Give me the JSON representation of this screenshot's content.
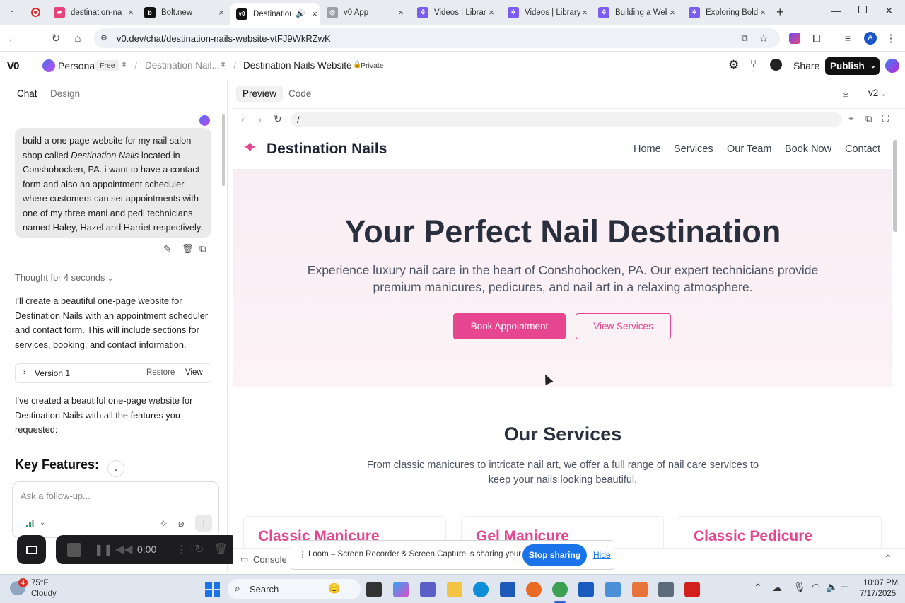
{
  "browser": {
    "tabs": [
      {
        "title": "destination-na",
        "color": "#e8437a",
        "glyph": "v0"
      },
      {
        "title": "Bolt.new",
        "color": "#111111",
        "glyph": "b"
      },
      {
        "title": "Destination",
        "color": "#111111",
        "glyph": "v0"
      },
      {
        "title": "v0 App",
        "color": "#666666",
        "glyph": "🌐"
      },
      {
        "title": "Videos | Library",
        "color": "#7b5cf0",
        "glyph": "✲"
      },
      {
        "title": "Videos | Library",
        "color": "#7b5cf0",
        "glyph": "✲"
      },
      {
        "title": "Building a Web",
        "color": "#7b5cf0",
        "glyph": "✲"
      },
      {
        "title": "Exploring Bold",
        "color": "#7b5cf0",
        "glyph": "✲"
      }
    ],
    "url": "v0.dev/chat/destination-nails-website-vtFJ9WkRZwK"
  },
  "app": {
    "workspace": "Personal",
    "plan_badge": "Free",
    "project_crumb": "Destination Nail...",
    "project_title": "Destination Nails Website",
    "privacy": "Private",
    "share_label": "Share",
    "publish_label": "Publish"
  },
  "left": {
    "tabs": [
      "Chat",
      "Design"
    ],
    "user_message_before": "build a one page website for my nail salon shop called ",
    "user_message_em": "Destination Nails",
    "user_message_after": " located in Conshohocken, PA. i want to have a contact form and also an appointment scheduler where customers can set appointments with one of my three mani and pedi technicians named Haley, Hazel and Harriet respectively.",
    "thought": "Thought for 4 seconds",
    "response_1": "I'll create a beautiful one-page website for Destination Nails with an appointment scheduler and contact form. This will include sections for services, booking, and contact information.",
    "version_label": "Version 1",
    "restore_label": "Restore",
    "view_label": "View",
    "response_2": "I've created a beautiful one-page website for Destination Nails with all the features you requested:",
    "key_features": "Key Features:",
    "input_placeholder": "Ask a follow-up..."
  },
  "recorder": {
    "time": "0:00"
  },
  "preview": {
    "tabs": [
      "Preview",
      "Code"
    ],
    "version": "v2",
    "path": "/",
    "console_label": "Console"
  },
  "site": {
    "brand": "Destination Nails",
    "nav": [
      "Home",
      "Services",
      "Our Team",
      "Book Now",
      "Contact"
    ],
    "hero_title": "Your Perfect Nail Destination",
    "hero_sub": "Experience luxury nail care in the heart of Conshohocken, PA. Our expert technicians provide premium manicures, pedicures, and nail art in a relaxing atmosphere.",
    "btn_primary": "Book Appointment",
    "btn_secondary": "View Services",
    "services_title": "Our Services",
    "services_sub": "From classic manicures to intricate nail art, we offer a full range of nail care services to keep your nails looking beautiful.",
    "cards": [
      "Classic Manicure",
      "Gel Manicure",
      "Classic Pedicure"
    ],
    "accent": "#e6468f"
  },
  "loom": {
    "message": "Loom – Screen Recorder & Screen Capture is sharing your screen.",
    "stop": "Stop sharing",
    "hide": "Hide"
  },
  "taskbar": {
    "temp": "75°F",
    "weather": "Cloudy",
    "search": "Search",
    "time": "10:07 PM",
    "date": "7/17/2025",
    "weather_badge": "4"
  }
}
